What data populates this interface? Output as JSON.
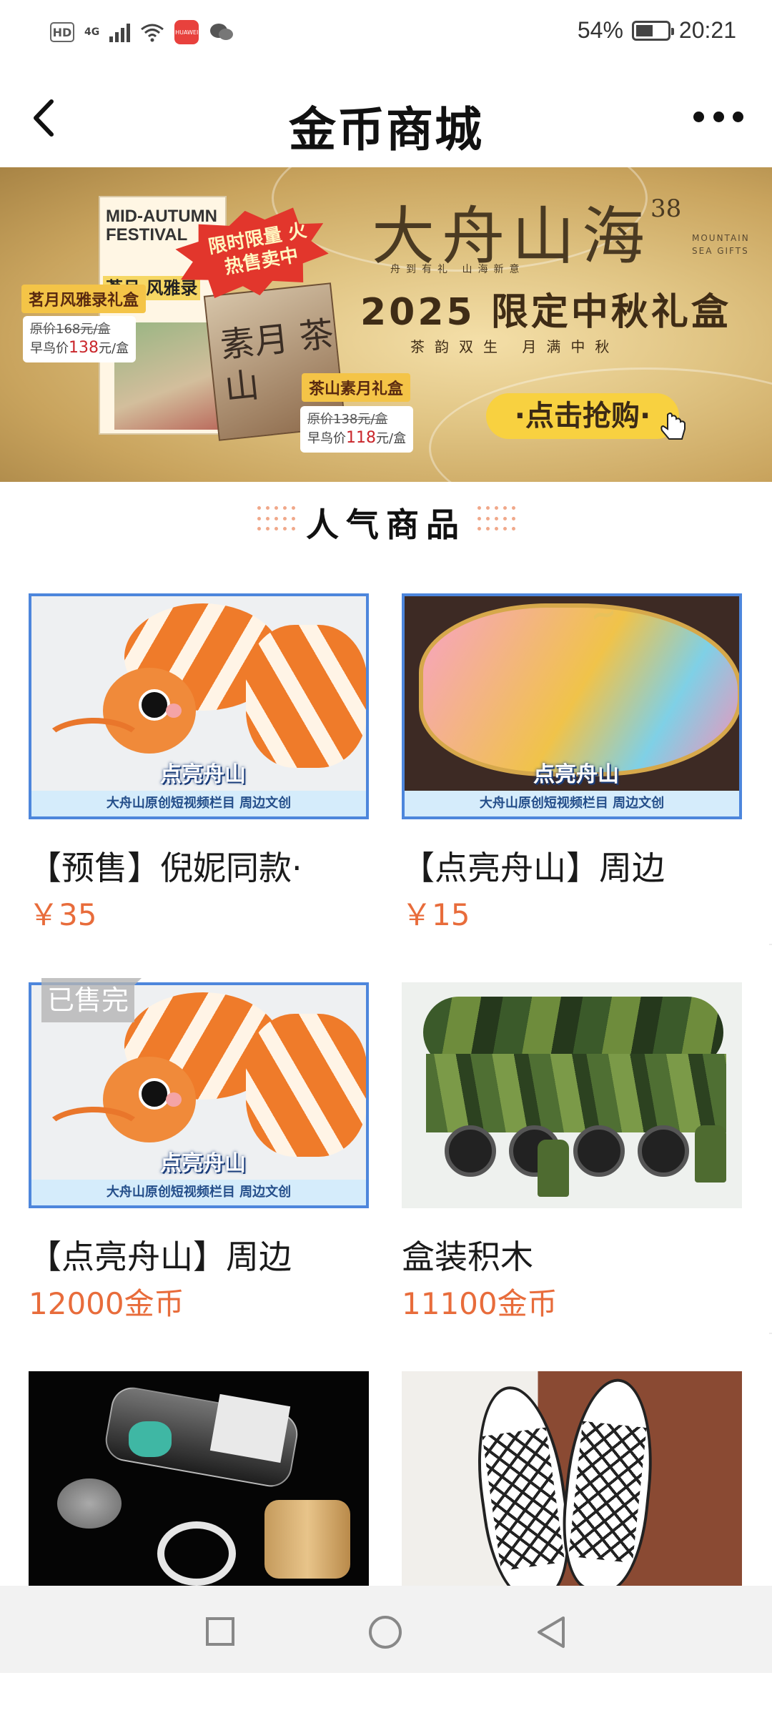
{
  "status_bar": {
    "hd": "HD",
    "network": "4G",
    "app_badge": "HUAWEI",
    "battery": "54%",
    "battery_level": 0.54,
    "time": "20:21"
  },
  "header": {
    "title": "金币商城"
  },
  "banner": {
    "box_title": "MID-AUTUMN FESTIVAL",
    "box_sub": "茗月 风雅录",
    "burst": "限时限量 火热售卖中",
    "tag1": "茗月风雅录礼盒",
    "tag1_old": "原价168元/盒",
    "tag1_new_prefix": "早鸟价",
    "tag1_new_price": "138",
    "tag1_new_suffix": "元/盒",
    "box2_calligraphy": "素月 茶山",
    "tag2": "茶山素月礼盒",
    "tag2_old": "原价138元/盒",
    "tag2_new_prefix": "早鸟价",
    "tag2_new_price": "118",
    "tag2_new_suffix": "元/盒",
    "brand": "大舟山海",
    "brand_num": "38",
    "brand_en": "MOUNTAIN SEA GIFTS",
    "brand_sub": "舟到有礼 山海新意",
    "headline": "2025 限定中秋礼盒",
    "subline": "茶韵双生 月满中秋",
    "cta": "·点击抢购·"
  },
  "section": {
    "title": "人气商品"
  },
  "products": [
    {
      "name": "【预售】倪妮同款·",
      "price": "￥35",
      "watermark": "点亮舟山",
      "caption": "大舟山原创短视频栏目 周边文创",
      "sold_out": ""
    },
    {
      "name": "【点亮舟山】周边",
      "price": "￥15",
      "watermark": "点亮舟山",
      "caption": "大舟山原创短视频栏目 周边文创",
      "sold_out": ""
    },
    {
      "name": "【点亮舟山】周边",
      "price": "12000金币",
      "watermark": "点亮舟山",
      "caption": "大舟山原创短视频栏目 周边文创",
      "sold_out": "已售完"
    },
    {
      "name": "盒装积木",
      "price": "11100金币",
      "watermark": "",
      "caption": "",
      "sold_out": ""
    },
    {
      "name": "",
      "price": "",
      "watermark": "",
      "caption": "",
      "sold_out": ""
    },
    {
      "name": "",
      "price": "",
      "watermark": "",
      "caption": "",
      "sold_out": ""
    }
  ],
  "colors": {
    "price": "#e86c3b",
    "frame": "#4d86dc",
    "cta": "#f8d140"
  },
  "icons": [
    "back-arrow-icon",
    "more-dots-icon",
    "wifi-icon",
    "signal-icon",
    "wechat-icon",
    "battery-icon",
    "nav-recent-icon",
    "nav-home-icon",
    "nav-back-icon"
  ]
}
